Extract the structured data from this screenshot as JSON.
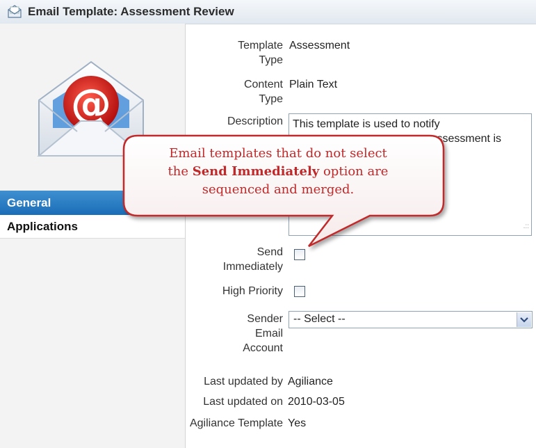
{
  "window": {
    "title": "Email Template: Assessment Review",
    "title_icon": "envelope-icon"
  },
  "sidebar": {
    "logo_icon": "email-at-envelope-icon",
    "items": [
      {
        "label": "General",
        "selected": true
      },
      {
        "label": "Applications",
        "selected": false
      }
    ]
  },
  "form": {
    "template_type": {
      "label_line1": "Template",
      "label_line2": "Type",
      "value": "Assessment"
    },
    "content_type": {
      "label_line1": "Content",
      "label_line2": "Type",
      "value": "Plain Text"
    },
    "description": {
      "label": "Description",
      "line1": "This template is used to notify",
      "line2": "ssessment is"
    },
    "send_immediately": {
      "label_line1": "Send",
      "label_line2": "Immediately",
      "checked": false
    },
    "high_priority": {
      "label": "High Priority",
      "checked": false
    },
    "sender_email_account": {
      "label_line1": "Sender",
      "label_line2": "Email",
      "label_line3": "Account",
      "selected": "-- Select --"
    },
    "last_updated_by": {
      "label": "Last updated by",
      "value": "Agiliance"
    },
    "last_updated_on": {
      "label": "Last updated on",
      "value": "2010-03-05"
    },
    "agiliance_template": {
      "label": "Agiliance Template",
      "value": "Yes"
    }
  },
  "callout": {
    "line1": "Email templates that do not select",
    "line2_pre": "the ",
    "line2_bold": "Send Immediately",
    "line2_post": " option are",
    "line3": "sequenced and merged.",
    "border_color": "#c0292a"
  },
  "colors": {
    "nav_selected": "#1a6eb7",
    "callout_text": "#c0292a"
  }
}
